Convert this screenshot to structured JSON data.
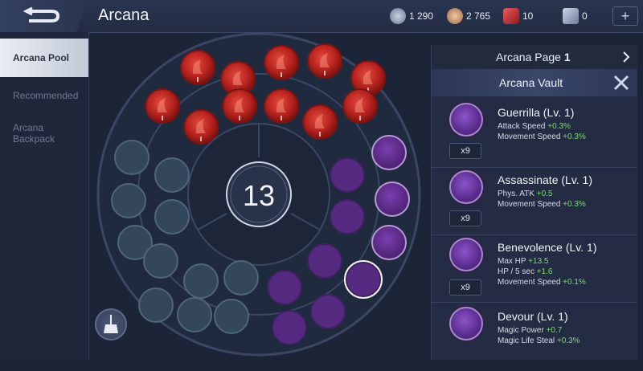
{
  "header": {
    "title": "Arcana"
  },
  "resources": [
    {
      "value": "1 290",
      "color": "#8f9bb8"
    },
    {
      "value": "2 765",
      "color": "#c99a72"
    },
    {
      "value": "10",
      "color": "#c2343a"
    },
    {
      "value": "0",
      "color": "#a7b0c8"
    }
  ],
  "sidebar": {
    "tabs": [
      {
        "label": "Arcana Pool"
      },
      {
        "label": "Recommended"
      },
      {
        "label": "Arcana Backpack"
      }
    ]
  },
  "board": {
    "center_count": "13"
  },
  "panel": {
    "page_label": "Arcana Page",
    "page_number": "1",
    "vault_title": "Arcana Vault",
    "items": [
      {
        "name": "Guerrilla (Lv. 1)",
        "count": "x9",
        "stats": [
          {
            "label": "Attack Speed",
            "value": "+0.3%"
          },
          {
            "label": "Movement Speed",
            "value": "+0.3%"
          }
        ]
      },
      {
        "name": "Assassinate (Lv. 1)",
        "count": "x9",
        "stats": [
          {
            "label": "Phys. ATK",
            "value": "+0.5"
          },
          {
            "label": "Movement Speed",
            "value": "+0.3%"
          }
        ]
      },
      {
        "name": "Benevolence (Lv. 1)",
        "count": "x9",
        "stats": [
          {
            "label": "Max HP",
            "value": "+13.5"
          },
          {
            "label": "HP / 5 sec",
            "value": "+1.6"
          },
          {
            "label": "Movement Speed",
            "value": "+0.1%"
          }
        ]
      },
      {
        "name": "Devour (Lv. 1)",
        "count": "",
        "stats": [
          {
            "label": "Magic Power",
            "value": "+0.7"
          },
          {
            "label": "Magic Life Steal",
            "value": "+0.3%"
          }
        ]
      }
    ]
  },
  "colors": {
    "red": "#b8231f",
    "purple": "#5f2c8c",
    "teal": "#34475a",
    "accent": "#7fd67a"
  }
}
